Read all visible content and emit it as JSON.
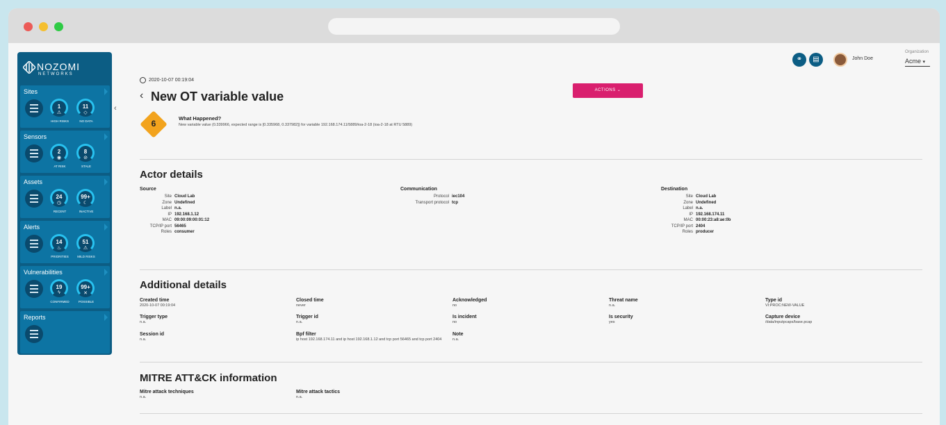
{
  "app": {
    "logo_main": "NOZOMI",
    "logo_sub": "NETWORKS"
  },
  "sidebar": {
    "sections": [
      {
        "title": "Sites",
        "gauges": [
          {
            "value": "1",
            "label": "HIGH RISKS",
            "icon": "warning-icon"
          },
          {
            "value": "11",
            "label": "NO DATA",
            "icon": "no-data-icon"
          }
        ]
      },
      {
        "title": "Sensors",
        "gauges": [
          {
            "value": "2",
            "label": "AT RISK",
            "icon": "eye-icon"
          },
          {
            "value": "8",
            "label": "STALE",
            "icon": "eye-slash-icon"
          }
        ]
      },
      {
        "title": "Assets",
        "gauges": [
          {
            "value": "24",
            "label": "RECENT",
            "icon": "clock-icon"
          },
          {
            "value": "99+",
            "label": "INACTIVE",
            "icon": "sleep-icon"
          }
        ]
      },
      {
        "title": "Alerts",
        "gauges": [
          {
            "value": "14",
            "label": "PRIORITIES",
            "icon": "flame-icon"
          },
          {
            "value": "51",
            "label": "MILD RISKS",
            "icon": "warning-icon"
          }
        ]
      },
      {
        "title": "Vulnerabilities",
        "gauges": [
          {
            "value": "19",
            "label": "CONFIRMED",
            "icon": "bolt-icon"
          },
          {
            "value": "99+",
            "label": "POSSIBLE",
            "icon": "bolt-slash-icon"
          }
        ]
      },
      {
        "title": "Reports",
        "gauges": []
      }
    ]
  },
  "header": {
    "user_name": "John Doe",
    "org_label": "Organization",
    "org_value": "Acme"
  },
  "alert": {
    "timestamp": "2020-10-07 00:19:04",
    "title": "New OT variable value",
    "actions_label": "ACTIONS",
    "risk": "6",
    "what_happened_title": "What Happened?",
    "what_happened_text": "New variable value (0.339966, expected range is [0.335968, 0.337982]) for variable 192.168.174.11/5889/ioa-2-18 (ioa-2-18 at RTU 5889)"
  },
  "actor": {
    "heading": "Actor details",
    "source": {
      "title": "Source",
      "rows": [
        {
          "k": "Site",
          "v": "Cloud Lab"
        },
        {
          "k": "Zone",
          "v": "Undefined"
        },
        {
          "k": "Label",
          "v": "n.a."
        },
        {
          "k": "IP",
          "v": "192.168.1.12"
        },
        {
          "k": "MAC",
          "v": "09:00:09:00:01:12"
        },
        {
          "k": "TCP/IP port",
          "v": "56465"
        },
        {
          "k": "Roles",
          "v": "consumer"
        }
      ]
    },
    "communication": {
      "title": "Communication",
      "rows": [
        {
          "k": "Protocol",
          "v": "iec104"
        },
        {
          "k": "Transport protocol",
          "v": "tcp"
        }
      ]
    },
    "destination": {
      "title": "Destination",
      "rows": [
        {
          "k": "Site",
          "v": "Cloud Lab"
        },
        {
          "k": "Zone",
          "v": "Undefined"
        },
        {
          "k": "Label",
          "v": "n.a."
        },
        {
          "k": "IP",
          "v": "192.168.174.11"
        },
        {
          "k": "MAC",
          "v": "00:00:23:a8:ae:0b"
        },
        {
          "k": "TCP/IP port",
          "v": "2404"
        },
        {
          "k": "Roles",
          "v": "producer"
        }
      ]
    }
  },
  "additional": {
    "heading": "Additional details",
    "fields": [
      {
        "label": "Created time",
        "value": "2020-10-07 00:19:04"
      },
      {
        "label": "Closed time",
        "value": "never"
      },
      {
        "label": "Acknowledged",
        "value": "no"
      },
      {
        "label": "Threat name",
        "value": "n.a."
      },
      {
        "label": "Type id",
        "value": "VI:PROC:NEW-VALUE"
      },
      {
        "label": "Trigger type",
        "value": "n.a."
      },
      {
        "label": "Trigger id",
        "value": "n.a."
      },
      {
        "label": "Is incident",
        "value": "no"
      },
      {
        "label": "Is security",
        "value": "yes"
      },
      {
        "label": "Capture device",
        "value": "/data/inputpcaps/base.pcap"
      },
      {
        "label": "Session id",
        "value": "n.a."
      },
      {
        "label": "Bpf filter",
        "value": "ip host 192.168.174.11 and ip host 192.168.1.12 and tcp port 56465 and tcp port 2404"
      },
      {
        "label": "Note",
        "value": "n.a."
      }
    ]
  },
  "mitre": {
    "heading": "MITRE ATT&CK information",
    "fields": [
      {
        "label": "Mitre attack techniques",
        "value": "n.a."
      },
      {
        "label": "Mitre attack tactics",
        "value": "n.a."
      }
    ]
  },
  "colors": {
    "sidebar_bg": "#0c5d84",
    "section_bg": "#0d74a3",
    "gauge_ring": "#28c2f0",
    "actions_bg": "#d91f6e",
    "risk_badge": "#f2a31d"
  }
}
